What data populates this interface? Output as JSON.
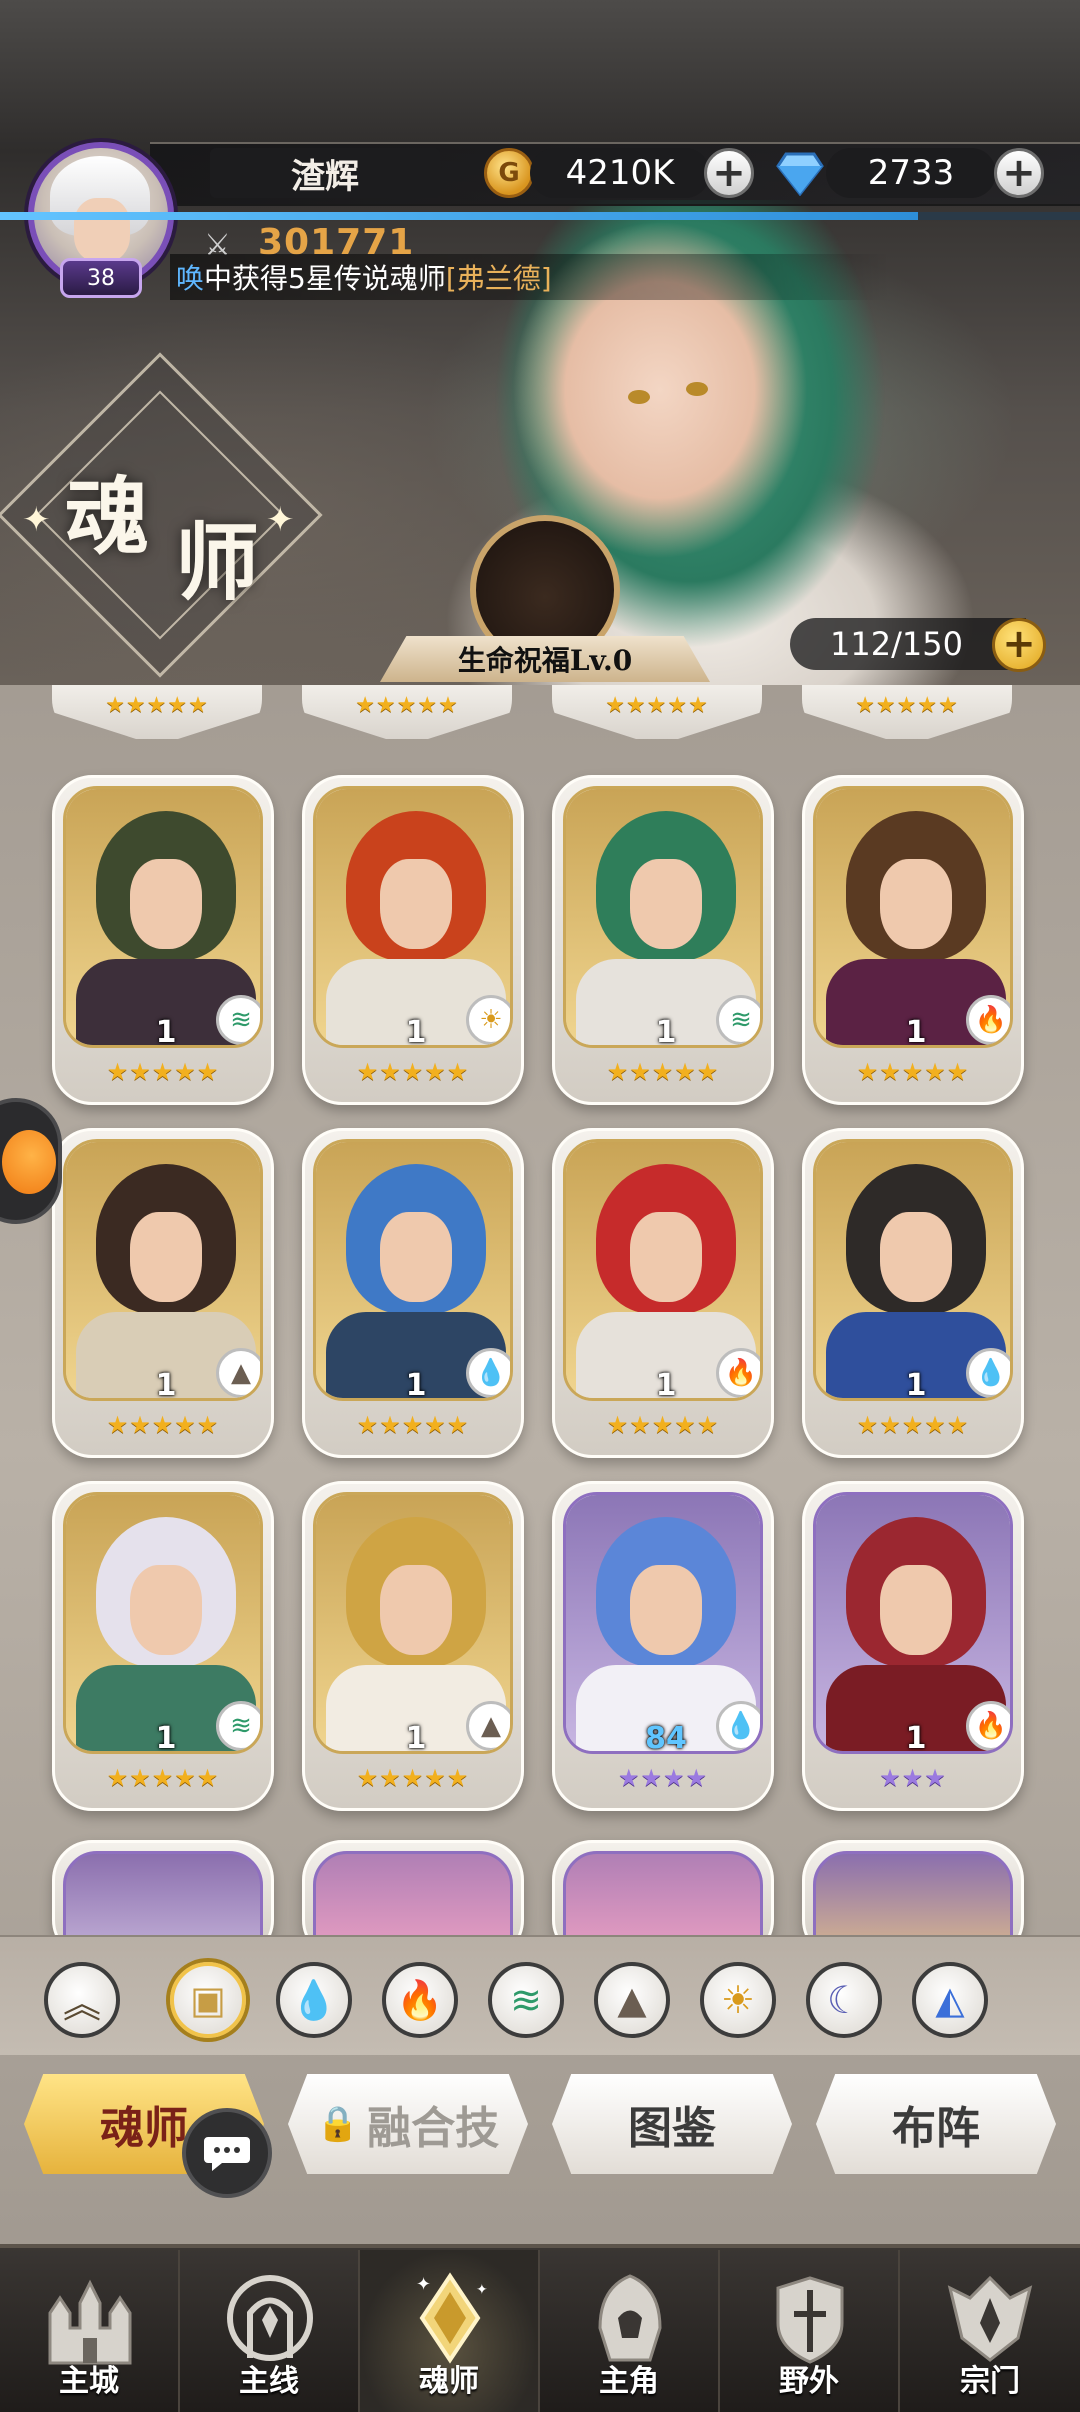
{
  "header": {
    "player_name": "渣辉",
    "level": "38",
    "power": "301771",
    "coins": "4210K",
    "diamonds": "2733",
    "exp_fraction": 0.85,
    "marquee_prefix": "唤",
    "marquee_main": "中获得5星传说魂师",
    "marquee_name": "[弗兰德]",
    "page_title_1": "魂",
    "page_title_2": "师",
    "blessing_label": "生命祝福Lv.0",
    "capacity": "112/150"
  },
  "cards": [
    {
      "level": "1",
      "element": "wind",
      "stars": "★★★★★",
      "tier": "gold",
      "hair": "#3e4a2e",
      "body": "#3d2f3a"
    },
    {
      "level": "1",
      "element": "light",
      "stars": "★★★★★",
      "tier": "gold",
      "hair": "#c9421c",
      "body": "#e7e2d8"
    },
    {
      "level": "1",
      "element": "wind",
      "stars": "★★★★★",
      "tier": "gold",
      "hair": "#2f7e5a",
      "body": "#e6e2dc"
    },
    {
      "level": "1",
      "element": "fire",
      "stars": "★★★★★",
      "tier": "gold",
      "hair": "#5a3a22",
      "body": "#5b2244"
    },
    {
      "level": "1",
      "element": "earth",
      "stars": "★★★★★",
      "tier": "gold",
      "hair": "#3b2a22",
      "body": "#d9cdb6"
    },
    {
      "level": "1",
      "element": "water",
      "stars": "★★★★★",
      "tier": "gold",
      "hair": "#3f79c6",
      "body": "#2d4564"
    },
    {
      "level": "1",
      "element": "fire",
      "stars": "★★★★★",
      "tier": "gold",
      "hair": "#c62b2b",
      "body": "#e6e1da"
    },
    {
      "level": "1",
      "element": "water",
      "stars": "★★★★★",
      "tier": "gold",
      "hair": "#2e2a28",
      "body": "#2f4f9c"
    },
    {
      "level": "1",
      "element": "wind",
      "stars": "★★★★★",
      "tier": "gold",
      "hair": "#e5e1ec",
      "body": "#3d7b63"
    },
    {
      "level": "1",
      "element": "earth",
      "stars": "★★★★★",
      "tier": "gold",
      "hair": "#cfa444",
      "body": "#f2ece2"
    },
    {
      "level": "84",
      "element": "water",
      "stars": "★★★★",
      "tier": "purple",
      "hair": "#5b86d8",
      "body": "#f2f0f6"
    },
    {
      "level": "1",
      "element": "fire",
      "stars": "★★★",
      "tier": "purple",
      "hair": "#9b2730",
      "body": "#7a1c24"
    }
  ],
  "prev_row_stars": "★★★★★",
  "filters": [
    {
      "name": "all-filter",
      "glyph": "︽"
    },
    {
      "name": "box-filter",
      "glyph": "▣"
    },
    {
      "name": "water-filter",
      "glyph": "💧"
    },
    {
      "name": "fire-filter",
      "glyph": "🔥"
    },
    {
      "name": "wind-filter",
      "glyph": "≋"
    },
    {
      "name": "earth-filter",
      "glyph": "▲"
    },
    {
      "name": "light-filter",
      "glyph": "☀"
    },
    {
      "name": "dark-filter",
      "glyph": "☾"
    },
    {
      "name": "special-filter",
      "glyph": "◭"
    }
  ],
  "tabs": {
    "soul_master": "魂师",
    "fusion": "融合技",
    "codex": "图鉴",
    "formation": "布阵"
  },
  "nav": {
    "main_city": "主城",
    "main_line": "主线",
    "soul_master": "魂师",
    "protagonist": "主角",
    "wild": "野外",
    "sect": "宗门"
  },
  "colors": {
    "accent_gold": "#e6b33d",
    "power_orange": "#e5a447",
    "marquee_blue": "#5fb7ff",
    "exp_blue": "#2d8ed8"
  }
}
